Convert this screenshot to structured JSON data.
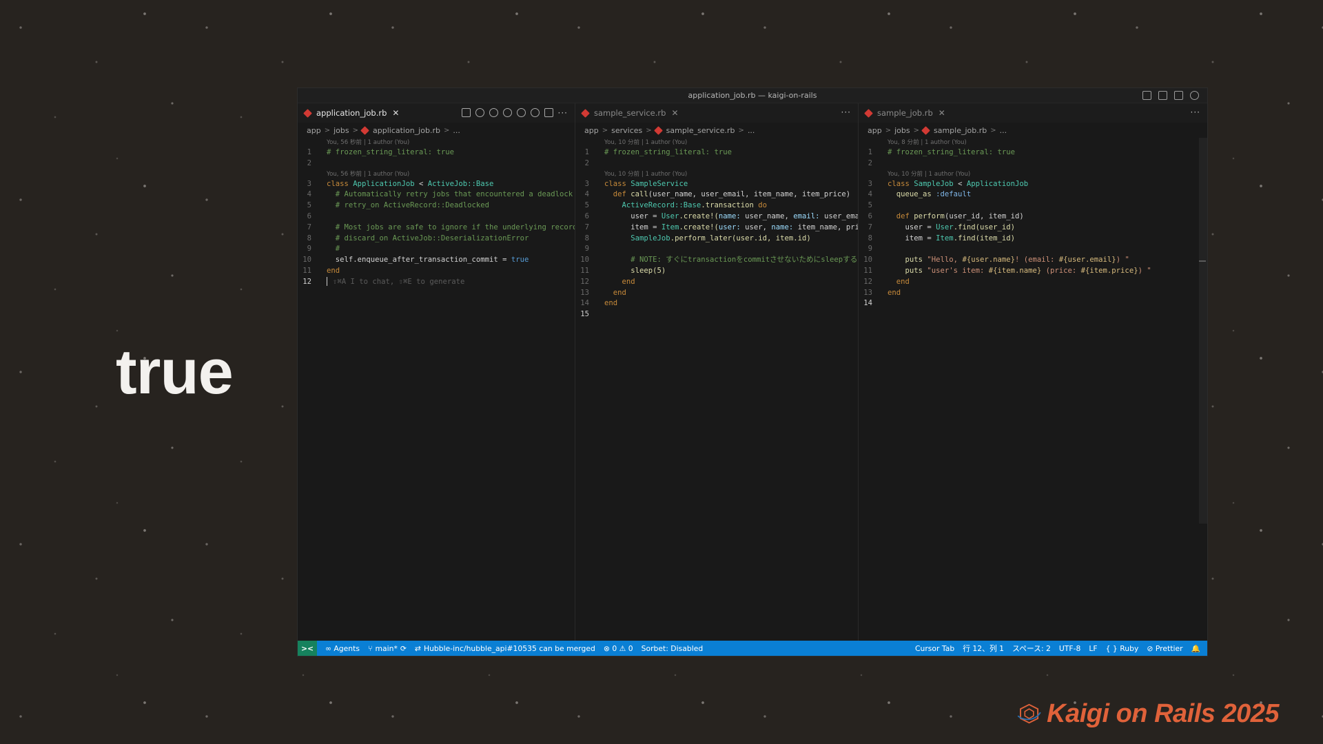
{
  "slide": {
    "word": "true",
    "brand": "Kaigi on Rails 2025",
    "brand_color": "#e0623a"
  },
  "window": {
    "title": "application_job.rb — kaigi-on-rails"
  },
  "panes": [
    {
      "tab": "application_job.rb",
      "active": true,
      "breadcrumb": [
        "app",
        "jobs",
        "application_job.rb",
        "..."
      ]
    },
    {
      "tab": "sample_service.rb",
      "active": false,
      "breadcrumb": [
        "app",
        "services",
        "sample_service.rb",
        "..."
      ]
    },
    {
      "tab": "sample_job.rb",
      "active": false,
      "breadcrumb": [
        "app",
        "jobs",
        "sample_job.rb",
        "..."
      ]
    }
  ],
  "blame": {
    "p1_a": "You, 56 秒前 | 1 author (You)",
    "p1_b": "You, 56 秒前 | 1 author (You)",
    "p2_a": "You, 10 分前 | 1 author (You)",
    "p2_b": "You, 10 分前 | 1 author (You)",
    "p3_a": "You, 8 分前 | 1 author (You)",
    "p3_b": "You, 10 分前 | 1 author (You)"
  },
  "code": {
    "p1": {
      "l1": "# frozen_string_literal: true",
      "l3_kw": "class ",
      "l3_cls": "ApplicationJob",
      "l3_op": " < ",
      "l3_base": "ActiveJob::Base",
      "l4": "  # Automatically retry jobs that encountered a deadlock",
      "l5": "  # retry_on ActiveRecord::Deadlocked",
      "l7": "  # Most jobs are safe to ignore if the underlying record",
      "l8": "  # discard_on ActiveJob::DeserializationError",
      "l9": "  #",
      "l10_a": "  self.enqueue_after_transaction_commit = ",
      "l10_b": "true",
      "l11": "end",
      "l12_hint": "⇧⌘A I to chat, ⇧⌘E to generate"
    },
    "p2": {
      "l1": "# frozen_string_literal: true",
      "l3_kw": "class ",
      "l3_cls": "SampleService",
      "l4_kw": "  def ",
      "l4_fn": "call",
      "l4_rest": "(user_name, user_email, item_name, item_price)",
      "l5_a": "    ActiveRecord::Base",
      "l5_b": ".transaction ",
      "l5_c": "do",
      "l6_a": "      user = ",
      "l6_b": "User",
      "l6_c": ".create!(",
      "l6_d": "name:",
      "l6_e": " user_name, ",
      "l6_f": "email:",
      "l6_g": " user_ema",
      "l7_a": "      item = ",
      "l7_b": "Item",
      "l7_c": ".create!(",
      "l7_d": "user:",
      "l7_e": " user, ",
      "l7_f": "name:",
      "l7_g": " item_name, pri",
      "l8_a": "      ",
      "l8_b": "SampleJob",
      "l8_c": ".perform_later(user.id, item.id)",
      "l10": "      # NOTE: すぐにtransactionをcommitさせないためにsleepする",
      "l11": "      sleep(5)",
      "l12": "    end",
      "l13": "  end",
      "l14": "end"
    },
    "p3": {
      "l1": "# frozen_string_literal: true",
      "l3_kw": "class ",
      "l3_cls": "SampleJob",
      "l3_op": " < ",
      "l3_base": "ApplicationJob",
      "l4_a": "  queue_as ",
      "l4_b": ":default",
      "l6_kw": "  def ",
      "l6_fn": "perform",
      "l6_rest": "(user_id, item_id)",
      "l7_a": "    user = ",
      "l7_b": "User",
      "l7_c": ".find(user_id)",
      "l8_a": "    item = ",
      "l8_b": "Item",
      "l8_c": ".find(item_id)",
      "l10_a": "    puts ",
      "l10_b": "\"Hello, ",
      "l10_c": "#{user.name}",
      "l10_d": "! (email: ",
      "l10_e": "#{user.email}",
      "l10_f": ") \"",
      "l11_a": "    puts ",
      "l11_b": "\"user's item: ",
      "l11_c": "#{item.name}",
      "l11_d": " (price: ",
      "l11_e": "#{item.price}",
      "l11_f": ") \"",
      "l12": "  end",
      "l13": "end"
    }
  },
  "status": {
    "remote": "><",
    "agents": "∞ Agents",
    "branch": "main*",
    "pr": "Hubble-inc/hubble_api#10535 can be merged",
    "problems": "⊗ 0 ⚠ 0",
    "sorbet": "Sorbet: Disabled",
    "cursor_tab": "Cursor Tab",
    "position": "行 12、列 1",
    "spaces": "スペース: 2",
    "encoding": "UTF-8",
    "eol": "LF",
    "language": "{ } Ruby",
    "prettier": "⊘ Prettier",
    "bell": "🔔"
  }
}
